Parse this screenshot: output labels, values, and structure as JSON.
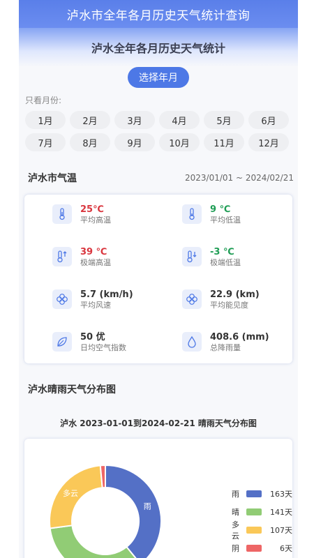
{
  "app_title": "泸水市全年各月历史天气统计查询",
  "hero_title": "泸水全年各月历史天气统计",
  "select_year_button": "选择年月",
  "months_label": "只看月份:",
  "months": [
    "1月",
    "2月",
    "3月",
    "4月",
    "5月",
    "6月",
    "7月",
    "8月",
    "9月",
    "10月",
    "11月",
    "12月"
  ],
  "temp_section": {
    "title": "泸水市气温",
    "date_range": "2023/01/01 ~ 2024/02/21"
  },
  "stats": [
    {
      "value": "25℃",
      "label": "平均高温",
      "icon": "thermometer-icon",
      "color": "#d9363e"
    },
    {
      "value": "9 ℃",
      "label": "平均低温",
      "icon": "thermometer-icon",
      "color": "#1f9d55"
    },
    {
      "value": "39 ℃",
      "label": "极端高温",
      "icon": "thermometer-up-icon",
      "color": "#d9363e"
    },
    {
      "value": "-3 ℃",
      "label": "极端低温",
      "icon": "thermometer-down-icon",
      "color": "#1f9d55"
    },
    {
      "value": "5.7 (km/h)",
      "label": "平均风速",
      "icon": "fan-icon",
      "color": "#333333"
    },
    {
      "value": "22.9 (km)",
      "label": "平均能见度",
      "icon": "fan-icon",
      "color": "#333333"
    },
    {
      "value": "50 优",
      "label": "日均空气指数",
      "icon": "leaf-icon",
      "color": "#333333"
    },
    {
      "value": "408.6 (mm)",
      "label": "总降雨量",
      "icon": "drop-icon",
      "color": "#333333"
    }
  ],
  "dist_section_title": "泸水晴雨天气分布图",
  "chart_data": {
    "type": "pie",
    "title": "泸水 2023-01-01到2024-02-21 晴雨天气分布图",
    "categories": [
      "雨",
      "晴",
      "多云",
      "阴"
    ],
    "values": [
      163,
      141,
      107,
      6
    ],
    "value_labels": [
      "163天",
      "141天",
      "107天",
      "6天"
    ],
    "colors": [
      "#5470c6",
      "#91cc75",
      "#fac858",
      "#ee6666"
    ],
    "legend": "right"
  }
}
